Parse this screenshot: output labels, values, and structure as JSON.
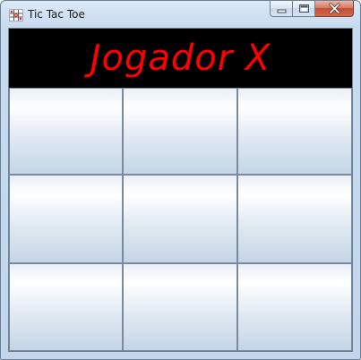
{
  "window": {
    "title": "Tic Tac Toe",
    "app_icon": "tic-tac-toe-app-icon",
    "controls": {
      "minimize_icon": "minimize-icon",
      "maximize_icon": "maximize-icon",
      "close_icon": "close-icon"
    }
  },
  "status": {
    "text": "Jogador X",
    "color": "#ff0000",
    "background": "#000000"
  },
  "board": {
    "cells": [
      "",
      "",
      "",
      "",
      "",
      "",
      "",
      "",
      ""
    ]
  }
}
